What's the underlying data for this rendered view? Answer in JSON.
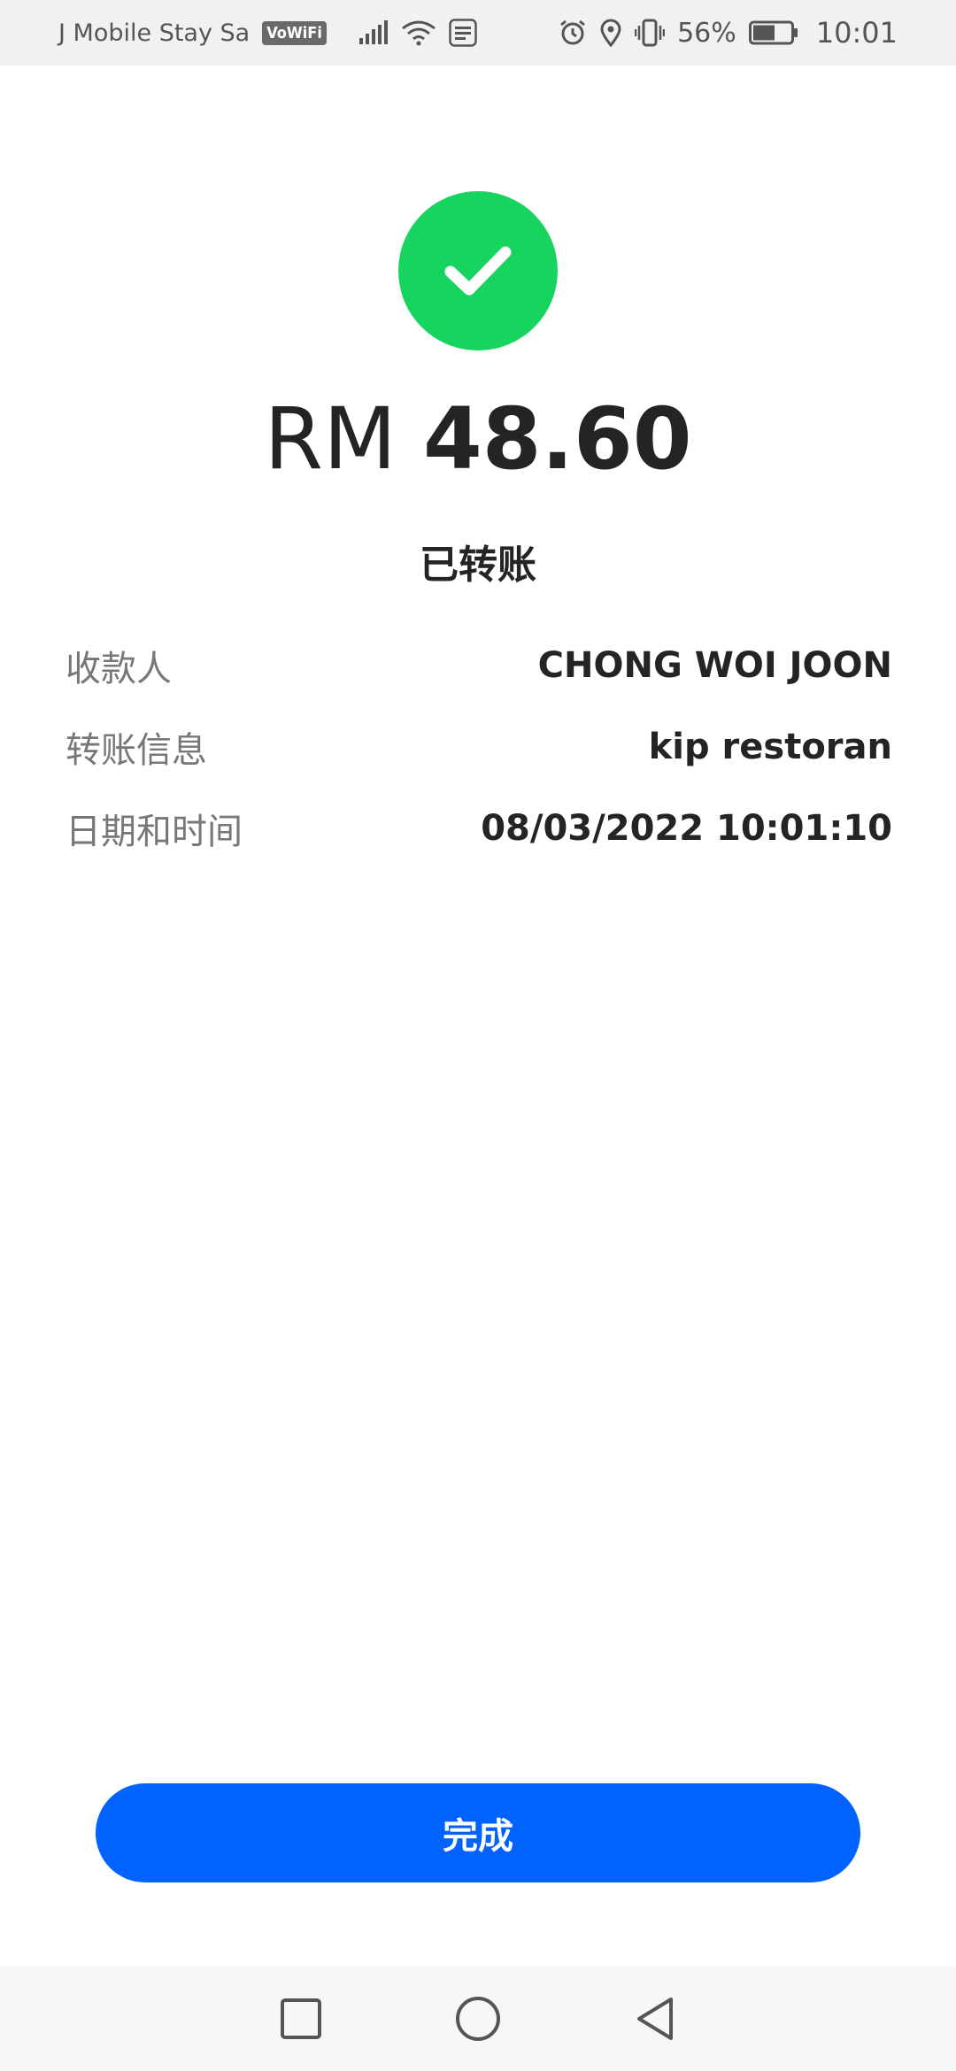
{
  "status_bar": {
    "carrier": "J Mobile Stay Sa",
    "vowifi_badge": "VoWiFi",
    "battery_percent": "56%",
    "time": "10:01",
    "icons": [
      "signal-icon",
      "wifi-icon",
      "touch-n-go-icon",
      "alarm-icon",
      "location-icon",
      "vibrate-icon",
      "battery-icon"
    ]
  },
  "receipt": {
    "success_icon": "check-circle-icon",
    "success_color": "#17d45f",
    "currency": "RM",
    "amount": "48.60",
    "status": "已转账",
    "details": [
      {
        "label": "收款人",
        "value": "CHONG WOI JOON"
      },
      {
        "label": "转账信息",
        "value": "kip restoran"
      },
      {
        "label": "日期和时间",
        "value": "08/03/2022 10:01:10"
      }
    ]
  },
  "actions": {
    "done_label": "完成",
    "done_color": "#0062ff"
  },
  "nav_bar": {
    "icons": [
      "recents-square-icon",
      "home-circle-icon",
      "back-triangle-icon"
    ]
  }
}
